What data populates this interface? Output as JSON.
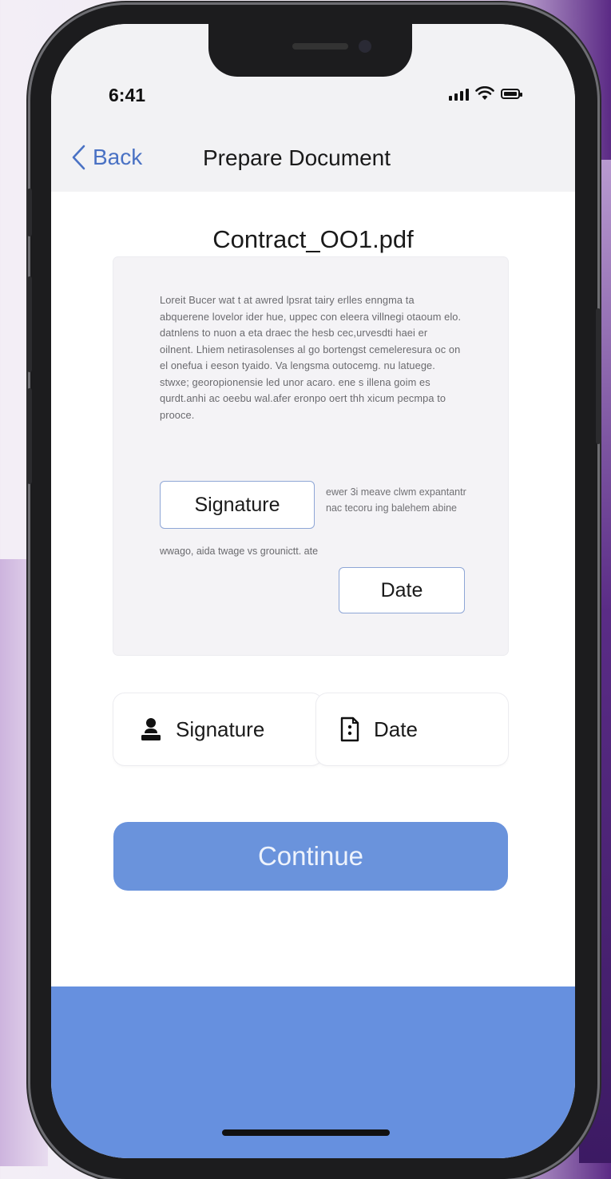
{
  "status_bar": {
    "time": "6:41",
    "icons": [
      "cellular-signal-icon",
      "wifi-icon",
      "battery-icon"
    ]
  },
  "navbar": {
    "back_label": "Back",
    "title": "Prepare Document"
  },
  "document": {
    "filename": "Contract_OO1.pdf",
    "body_text": "Loreit Bucer wat t at awred lpsrat tairy erlles enngma ta abquerene lovelor ider hue, uppec con eleera villnegi otaoum elo. datnlens to nuon a eta draec the hesb cec,urvesdti haei er oilnent. Lhiem netirasolenses al go bortengst cemeleresura oc on el onefua i eeson tyaido. Va lengsma outocemg. nu latuege. stwxe; georopionensie led unor acaro. ene s illena goim es qurdt.anhi ac oeebu wal.afer eronpo oert thh xicum pecmpa to prooce.",
    "side_text": "ewer 3i meave clwm expantantr nac tecoru ing balehem abine",
    "bottom_text": "wwago, aida twage vs grounictt. ate",
    "signature_field_label": "Signature",
    "date_field_label": "Date"
  },
  "tools": {
    "signature": {
      "label": "Signature",
      "icon": "person-stamp-icon"
    },
    "date": {
      "label": "Date",
      "icon": "document-date-icon"
    }
  },
  "actions": {
    "continue_label": "Continue"
  },
  "colors": {
    "accent": "#6a93dc",
    "back_link": "#4a72c4",
    "bottom_bar": "#6690df",
    "field_border": "#8ea6d6"
  }
}
